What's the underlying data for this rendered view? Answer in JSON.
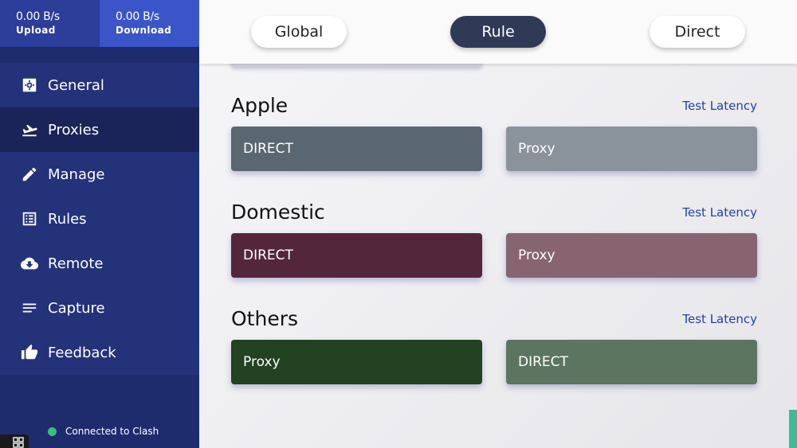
{
  "traffic": {
    "upload": {
      "rate": "0.00 B/s",
      "label": "Upload"
    },
    "download": {
      "rate": "0.00 B/s",
      "label": "Download"
    }
  },
  "sidebar": {
    "items": [
      {
        "label": "General",
        "icon": "settings-icon"
      },
      {
        "label": "Proxies",
        "icon": "flight-icon",
        "active": true
      },
      {
        "label": "Manage",
        "icon": "pencil-icon"
      },
      {
        "label": "Rules",
        "icon": "list-icon"
      },
      {
        "label": "Remote",
        "icon": "cloud-download-icon"
      },
      {
        "label": "Capture",
        "icon": "lines-icon"
      },
      {
        "label": "Feedback",
        "icon": "thumbs-up-icon"
      }
    ],
    "status": "Connected to Clash"
  },
  "modes": {
    "global": "Global",
    "rule": "Rule",
    "direct": "Direct",
    "selected": "Rule"
  },
  "groups": [
    {
      "name": "Apple",
      "latency_label": "Test Latency",
      "options": [
        {
          "label": "DIRECT",
          "color": "#5b6770"
        },
        {
          "label": "Proxy",
          "color": "#8a939b"
        }
      ]
    },
    {
      "name": "Domestic",
      "latency_label": "Test Latency",
      "options": [
        {
          "label": "DIRECT",
          "color": "#54263c"
        },
        {
          "label": "Proxy",
          "color": "#866470"
        }
      ]
    },
    {
      "name": "Others",
      "latency_label": "Test Latency",
      "options": [
        {
          "label": "Proxy",
          "color": "#224222"
        },
        {
          "label": "DIRECT",
          "color": "#5c7560"
        }
      ]
    }
  ],
  "colors": {
    "sidebar_bg": "#1e2c6e",
    "nav_item_bg": "#243279",
    "nav_active_bg": "#1a2459",
    "upload_bg": "#2c3d9a",
    "download_bg": "#3a55c8",
    "rule_button_bg": "#2f3a57",
    "link": "#2440a4",
    "status_dot": "#3dbb86"
  }
}
